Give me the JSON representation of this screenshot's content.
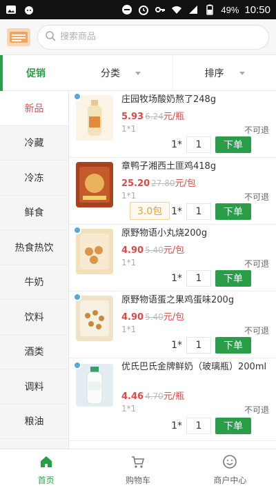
{
  "status_bar": {
    "battery": "49%",
    "time": "10:50",
    "icons": [
      "gallery-icon",
      "cat-icon",
      "no-disturb-icon",
      "alarm-icon",
      "key-icon",
      "wifi-icon",
      "signal-icon",
      "battery-icon"
    ]
  },
  "header": {
    "search_placeholder": "搜索商品"
  },
  "tabs": {
    "promo": "促销",
    "category": "分类",
    "sort": "排序"
  },
  "sidebar": {
    "items": [
      "新品",
      "冷藏",
      "冷冻",
      "鲜食",
      "热食热饮",
      "牛奶",
      "饮料",
      "酒类",
      "调料",
      "粮油"
    ],
    "active_index": 0
  },
  "products": [
    {
      "name": "庄园牧场酸奶熬了248g",
      "price": "5.93",
      "old_price": "6.24",
      "unit": "元/瓶",
      "qty_spec": "1*1",
      "return_note": "不可退",
      "qty_prefix": "1*",
      "qty": "1",
      "order_label": "下单"
    },
    {
      "name": "章鸭子湘西土匪鸡418g",
      "price": "25.20",
      "old_price": "27.80",
      "unit": "元/包",
      "qty_spec": "1*1",
      "return_note": "不可退",
      "pack_label": "3.0包",
      "qty_prefix": "1*",
      "qty": "1",
      "order_label": "下单"
    },
    {
      "name": "原野物语小丸烧200g",
      "price": "4.90",
      "old_price": "5.40",
      "unit": "元/包",
      "qty_spec": "1*1",
      "return_note": "不可退",
      "qty_prefix": "1*",
      "qty": "1",
      "order_label": "下单"
    },
    {
      "name": "原野物语蛋之果鸡蛋味200g",
      "price": "4.90",
      "old_price": "5.40",
      "unit": "元/包",
      "qty_spec": "1*1",
      "return_note": "不可退",
      "qty_prefix": "1*",
      "qty": "1",
      "order_label": "下单"
    },
    {
      "name": "优氏巴氏金牌鲜奶（玻璃瓶）200ml",
      "price": "4.46",
      "old_price": "4.70",
      "unit": "元/瓶",
      "qty_spec": "1*1",
      "return_note": "不可退",
      "qty_prefix": "1*",
      "qty": "1",
      "order_label": "下单"
    }
  ],
  "bottom_nav": {
    "items": [
      {
        "label": "首页",
        "icon": "home-icon",
        "active": true
      },
      {
        "label": "购物车",
        "icon": "cart-icon",
        "active": false
      },
      {
        "label": "商户中心",
        "icon": "smile-icon",
        "active": false
      }
    ]
  },
  "colors": {
    "accent_green": "#2a9d49",
    "price_red": "#e04848",
    "pack_orange": "#e0a43a"
  }
}
